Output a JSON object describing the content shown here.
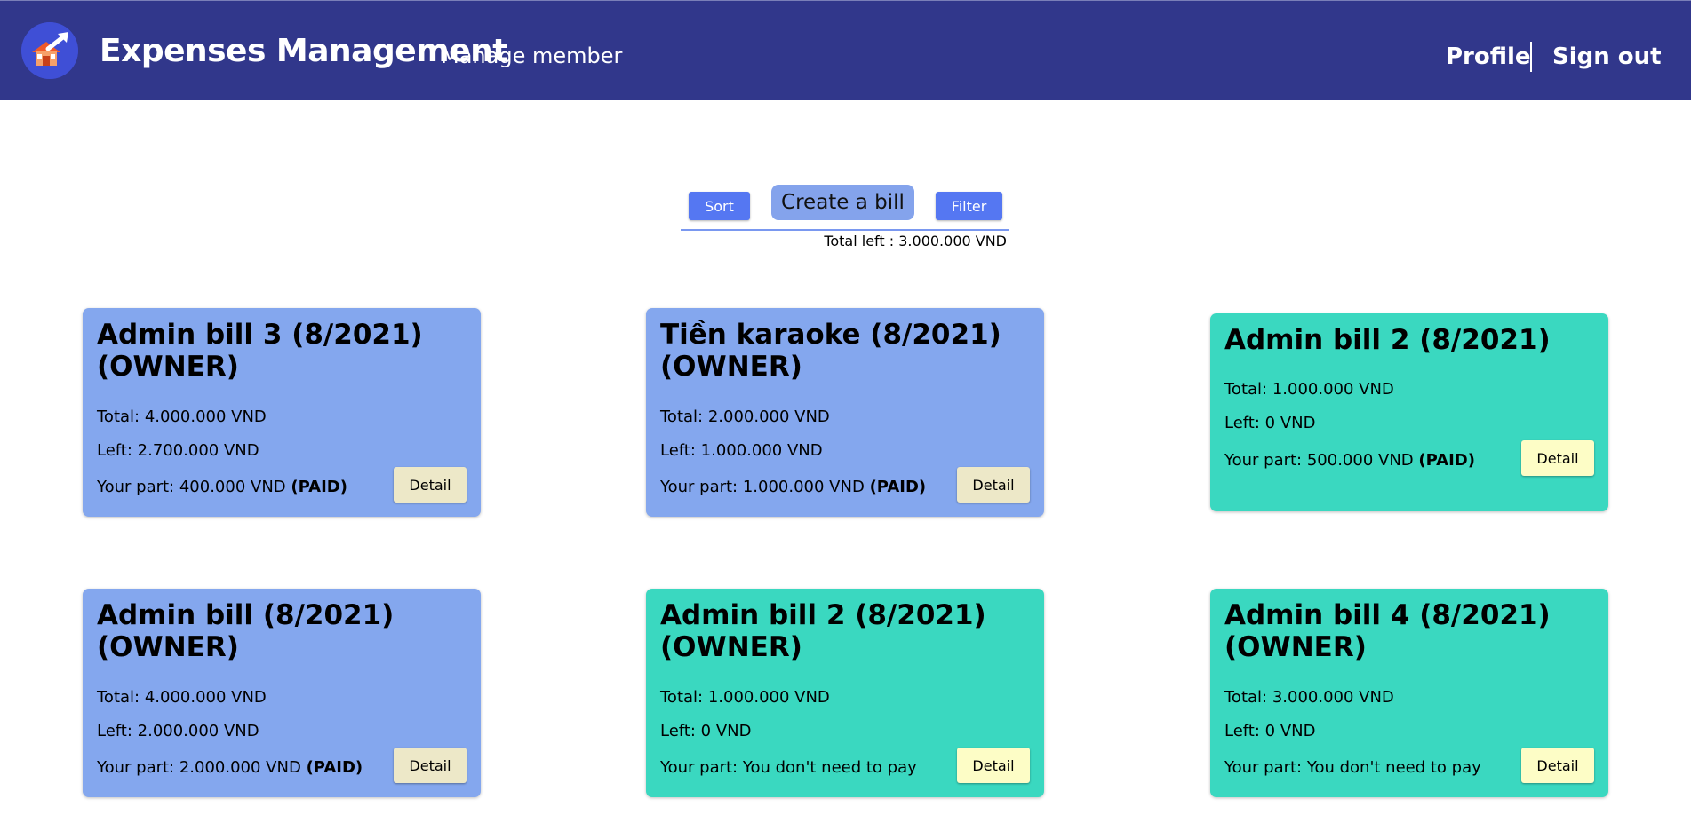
{
  "header": {
    "brand": "Expenses Management",
    "manage_member": "Manage member",
    "profile": "Profile",
    "sign_out": "Sign out"
  },
  "toolbar": {
    "sort": "Sort",
    "create": "Create a bill",
    "filter": "Filter",
    "total_left": "Total left : 3.000.000 VND"
  },
  "cards": [
    {
      "title": "Admin bill 3 (8/2021) (OWNER)",
      "total": "Total: 4.000.000 VND",
      "left": "Left: 2.700.000 VND",
      "part": "Your part: 400.000 VND",
      "paid": "(PAID)",
      "detail": "Detail",
      "color": "#84a7ee"
    },
    {
      "title": "Tiền karaoke (8/2021) (OWNER)",
      "total": "Total: 2.000.000 VND",
      "left": "Left: 1.000.000 VND",
      "part": "Your part: 1.000.000 VND",
      "paid": "(PAID)",
      "detail": "Detail",
      "color": "#84a7ee"
    },
    {
      "title": "Admin bill 2 (8/2021)",
      "total": "Total: 1.000.000 VND",
      "left": "Left: 0 VND",
      "part": "Your part: 500.000 VND",
      "paid": "(PAID)",
      "detail": "Detail",
      "color": "#3ad8c0"
    },
    {
      "title": "Admin bill (8/2021) (OWNER)",
      "total": "Total: 4.000.000 VND",
      "left": "Left: 2.000.000 VND",
      "part": "Your part: 2.000.000 VND",
      "paid": "(PAID)",
      "detail": "Detail",
      "color": "#84a7ee"
    },
    {
      "title": "Admin bill 2 (8/2021) (OWNER)",
      "total": "Total: 1.000.000 VND",
      "left": "Left: 0 VND",
      "part": "Your part: You don't need to pay",
      "paid": "",
      "detail": "Detail",
      "color": "#3ad8c0"
    },
    {
      "title": "Admin bill 4 (8/2021) (OWNER)",
      "total": "Total: 3.000.000 VND",
      "left": "Left: 0 VND",
      "part": "Your part: You don't need to pay",
      "paid": "",
      "detail": "Detail",
      "color": "#3ad8c0"
    }
  ]
}
